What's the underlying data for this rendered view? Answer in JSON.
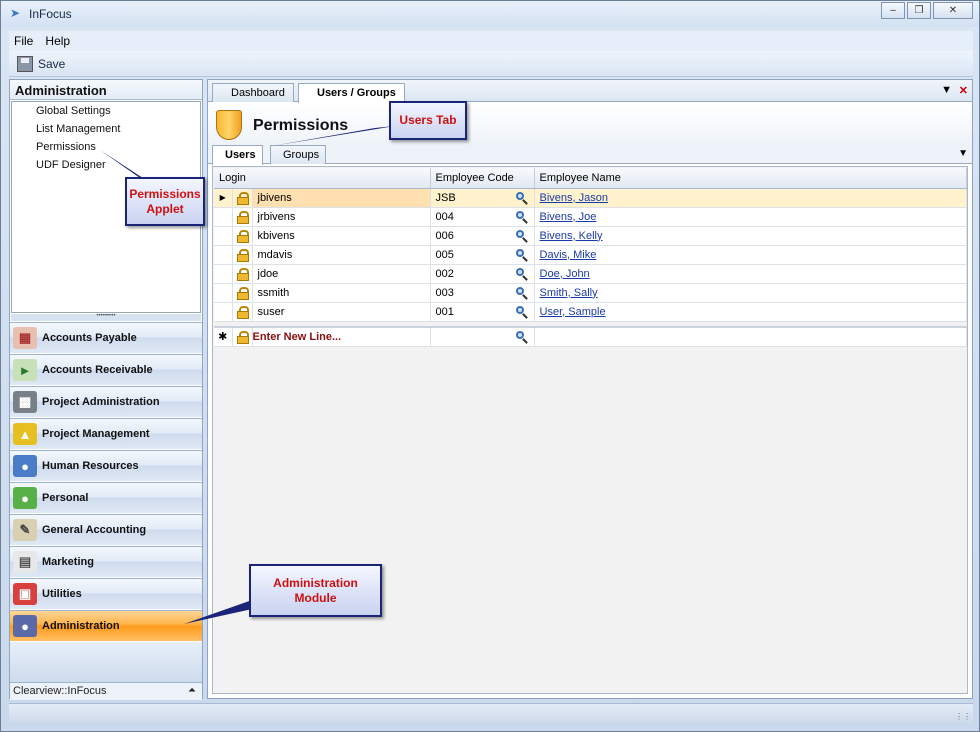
{
  "window": {
    "title": "InFocus"
  },
  "menu": {
    "file": "File",
    "help": "Help"
  },
  "toolbar": {
    "save_label": "Save"
  },
  "left": {
    "header": "Administration",
    "applets": [
      "Global Settings",
      "List Management",
      "Permissions",
      "UDF Designer"
    ],
    "modules": [
      {
        "label": "Accounts Payable",
        "icon": "ledger-icon"
      },
      {
        "label": "Accounts Receivable",
        "icon": "ledger-arrow-icon"
      },
      {
        "label": "Project Administration",
        "icon": "building-icon"
      },
      {
        "label": "Project Management",
        "icon": "hardhat-icon"
      },
      {
        "label": "Human Resources",
        "icon": "people-icon"
      },
      {
        "label": "Personal",
        "icon": "person-icon"
      },
      {
        "label": "General Accounting",
        "icon": "calculator-icon"
      },
      {
        "label": "Marketing",
        "icon": "document-icon"
      },
      {
        "label": "Utilities",
        "icon": "toolbox-icon"
      },
      {
        "label": "Administration",
        "icon": "admin-person-icon"
      }
    ],
    "footer": "Clearview::InFocus"
  },
  "doc_tabs": [
    "Dashboard",
    "Users / Groups"
  ],
  "page": {
    "title": "Permissions"
  },
  "sub_tabs": [
    "Users",
    "Groups"
  ],
  "grid": {
    "columns": [
      "Login",
      "Employee Code",
      "Employee Name"
    ],
    "rows": [
      {
        "login": "jbivens",
        "code": "JSB",
        "name": "Bivens, Jason"
      },
      {
        "login": "jrbivens",
        "code": "004",
        "name": "Bivens, Joe"
      },
      {
        "login": "kbivens",
        "code": "006",
        "name": "Bivens, Kelly"
      },
      {
        "login": "mdavis",
        "code": "005",
        "name": "Davis, Mike"
      },
      {
        "login": "jdoe",
        "code": "002",
        "name": "Doe, John"
      },
      {
        "login": "ssmith",
        "code": "003",
        "name": "Smith, Sally"
      },
      {
        "login": "suser",
        "code": "001",
        "name": "User, Sample"
      }
    ],
    "new_line": "Enter New Line..."
  },
  "callouts": {
    "users_tab": "Users Tab",
    "permissions_applet_l1": "Permissions",
    "permissions_applet_l2": "Applet",
    "admin_module_l1": "Administration",
    "admin_module_l2": "Module"
  },
  "colors": {
    "active_module": "#ff9a1a",
    "callout_text": "#d01010",
    "link": "#1a3aa8"
  }
}
